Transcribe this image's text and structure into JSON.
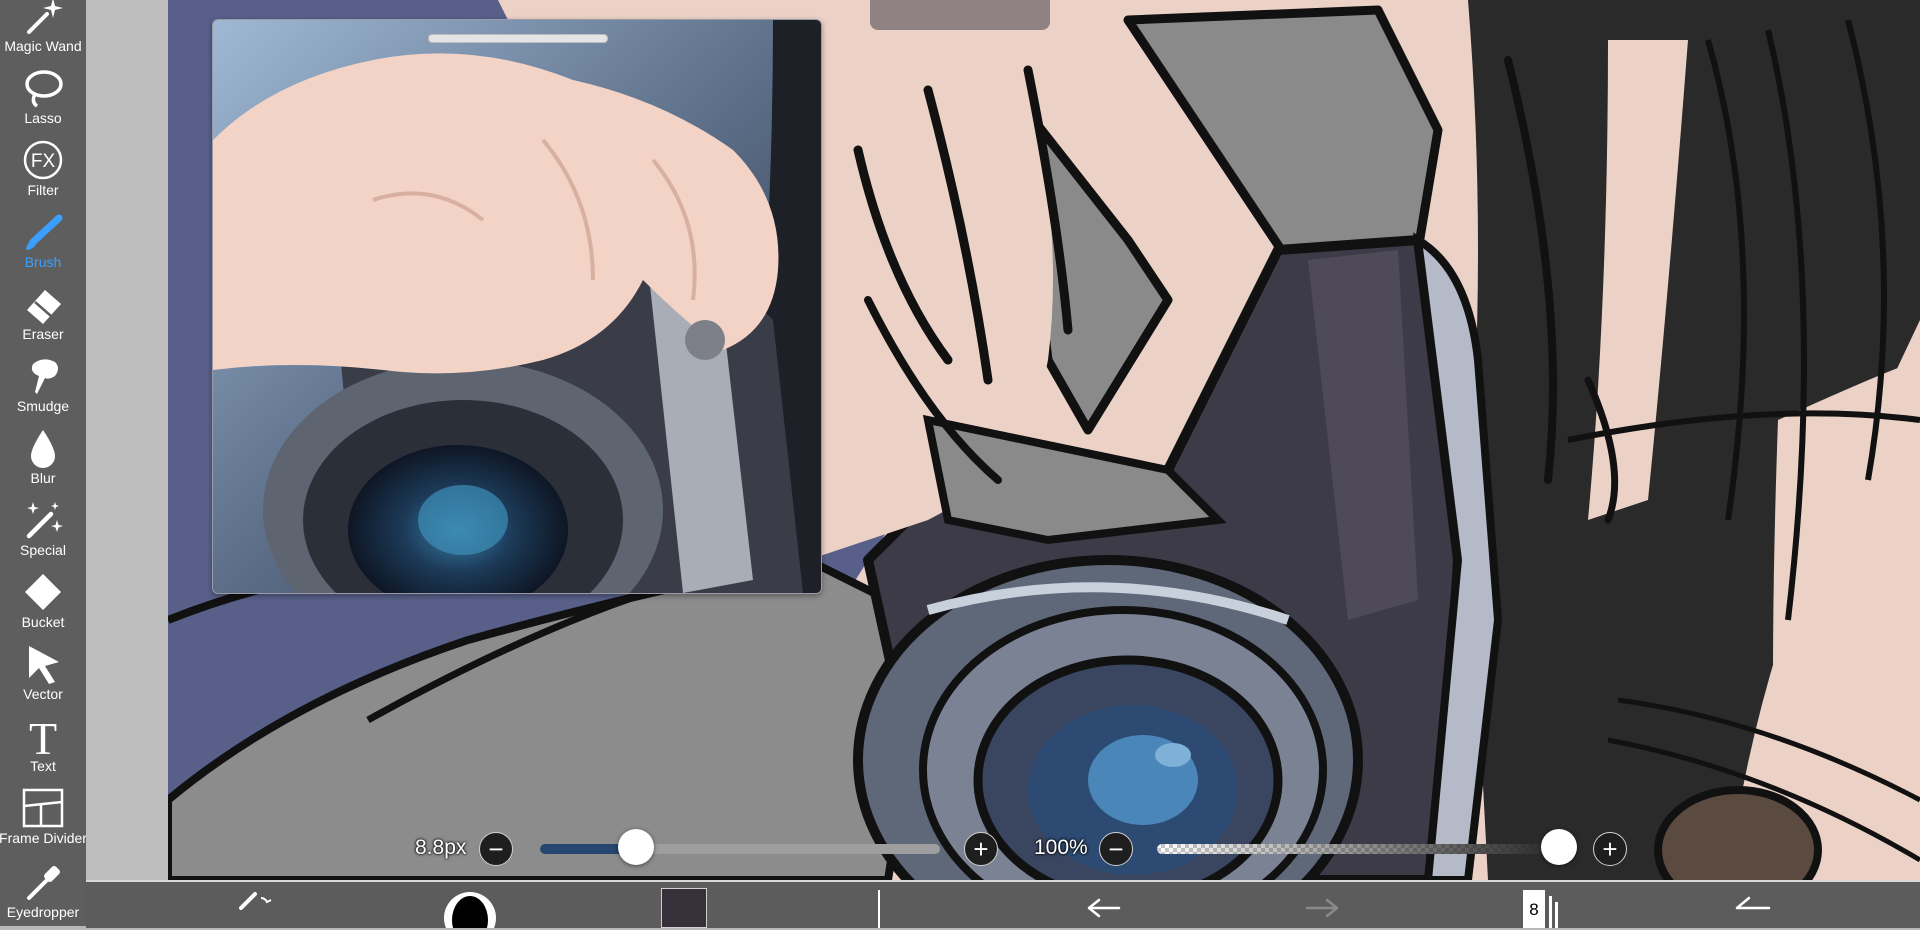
{
  "toolbar": {
    "tools": [
      {
        "id": "magic-wand",
        "label": "Magic Wand",
        "icon": "magic-wand-icon"
      },
      {
        "id": "lasso",
        "label": "Lasso",
        "icon": "lasso-icon"
      },
      {
        "id": "filter",
        "label": "Filter",
        "icon": "fx-icon",
        "icon_text": "FX"
      },
      {
        "id": "brush",
        "label": "Brush",
        "icon": "brush-icon",
        "active": true
      },
      {
        "id": "eraser",
        "label": "Eraser",
        "icon": "eraser-icon"
      },
      {
        "id": "smudge",
        "label": "Smudge",
        "icon": "smudge-icon"
      },
      {
        "id": "blur",
        "label": "Blur",
        "icon": "droplet-icon"
      },
      {
        "id": "special",
        "label": "Special",
        "icon": "sparkle-brush-icon"
      },
      {
        "id": "bucket",
        "label": "Bucket",
        "icon": "bucket-icon"
      },
      {
        "id": "vector",
        "label": "Vector",
        "icon": "cursor-arrow-icon"
      },
      {
        "id": "text",
        "label": "Text",
        "icon": "text-t-icon",
        "icon_text": "T"
      },
      {
        "id": "frame-divider",
        "label": "Frame Divider",
        "icon": "frame-divider-icon"
      },
      {
        "id": "eyedropper",
        "label": "Eyedropper",
        "icon": "eyedropper-icon"
      }
    ],
    "active_color": "#3aa0ff"
  },
  "brush_size": {
    "value_label": "8.8px",
    "level": 0.24,
    "minus": "−",
    "plus": "+"
  },
  "opacity": {
    "value_label": "100%",
    "level": 1.0,
    "minus": "−",
    "plus": "+"
  },
  "bottom_bar": {
    "layers_count": "8",
    "current_color": "#35303a",
    "icons": [
      "brush-settings-icon",
      "brush-preview-icon",
      "color-swatch",
      "stabilizer-line-icon",
      "undo-icon",
      "redo-icon",
      "layers-icon",
      "back-arrow-icon"
    ]
  },
  "reference_window": {
    "title": "",
    "image": "reference photo of hand holding camera"
  }
}
